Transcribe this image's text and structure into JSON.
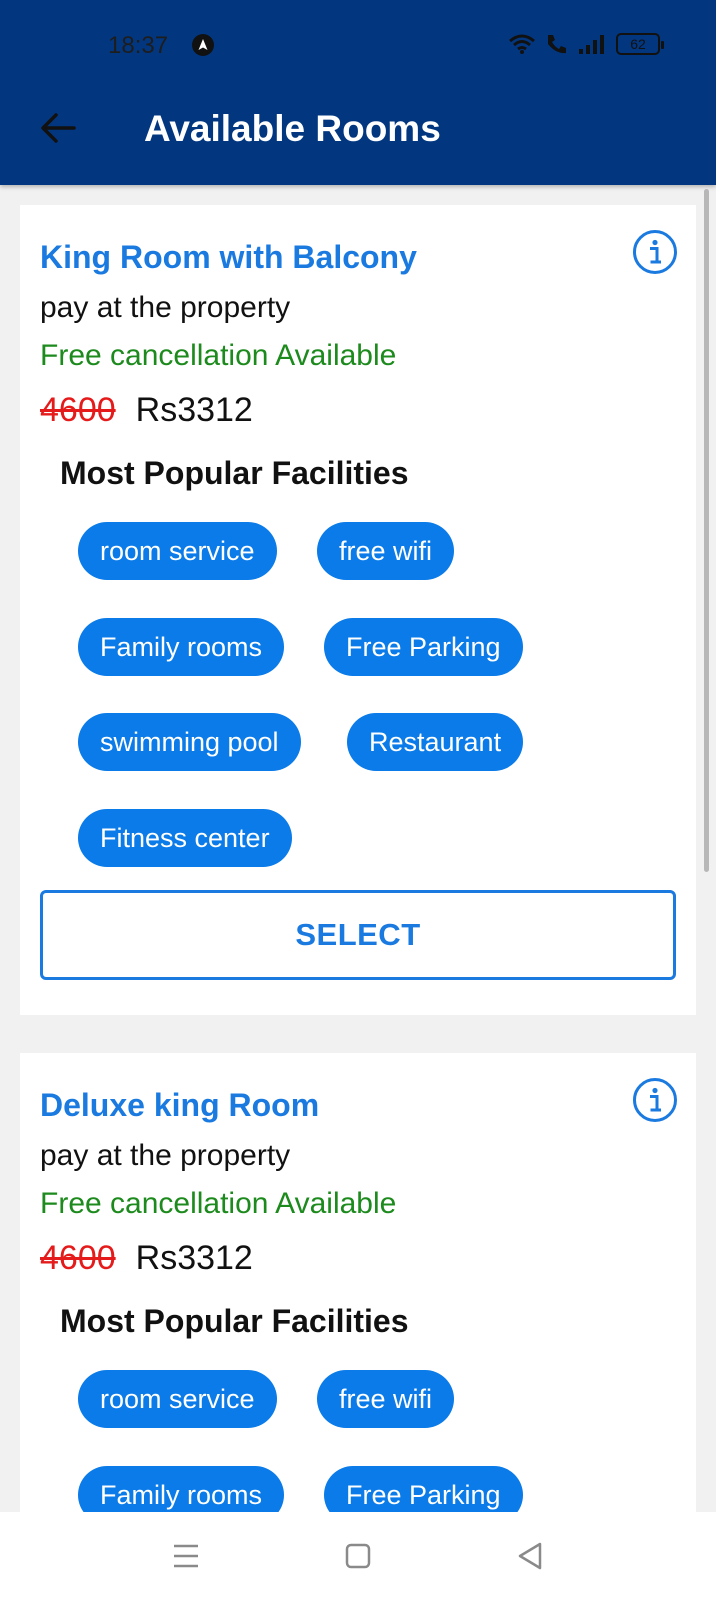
{
  "status": {
    "time": "18:37",
    "battery": "62",
    "icons": [
      "navigation-icon",
      "wifi-icon",
      "wifi-call-icon",
      "signal-icon",
      "battery-icon"
    ]
  },
  "appbar": {
    "title": "Available Rooms",
    "back_icon": "back-arrow-icon"
  },
  "rooms": [
    {
      "name": "King Room with Balcony",
      "payment": "pay at the property",
      "cancellation": "Free cancellation Available",
      "old_price": "4600",
      "price": "Rs3312",
      "facilities_title": "Most Popular Facilities",
      "facilities": [
        "room service",
        "free wifi",
        "Family rooms",
        "Free Parking",
        "swimming pool",
        "Restaurant",
        "Fitness center"
      ],
      "select_label": "SELECT"
    },
    {
      "name": "Deluxe king Room",
      "payment": "pay at the property",
      "cancellation": "Free cancellation Available",
      "old_price": "4600",
      "price": "Rs3312",
      "facilities_title": "Most Popular Facilities",
      "facilities": [
        "room service",
        "free wifi",
        "Family rooms",
        "Free Parking"
      ]
    }
  ],
  "colors": {
    "appbar": "#023780",
    "accent": "#1a7ae0",
    "chip": "#0a7be8",
    "green": "#1c8a1c",
    "strike": "#e51a1a"
  },
  "navbar": {
    "icons": [
      "recent-apps-icon",
      "home-icon",
      "back-icon"
    ]
  }
}
